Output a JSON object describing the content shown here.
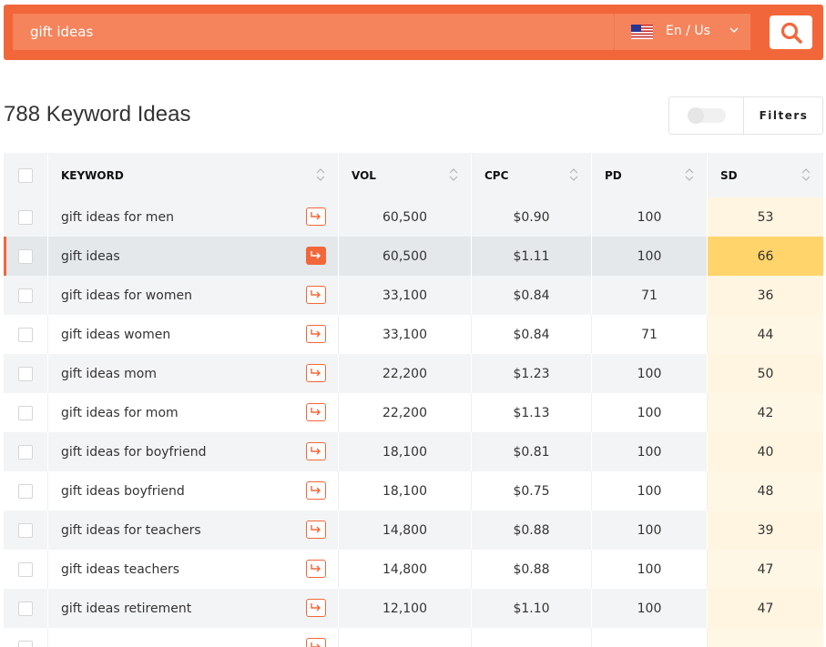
{
  "search": {
    "query": "gift ideas",
    "language": "En / Us"
  },
  "results": {
    "title": "788 Keyword Ideas",
    "filters_label": "Filters"
  },
  "table": {
    "columns": [
      "KEYWORD",
      "VOL",
      "CPC",
      "PD",
      "SD"
    ],
    "rows": [
      {
        "keyword": "gift ideas for men",
        "vol": "60,500",
        "cpc": "$0.90",
        "pd": "100",
        "sd": "53"
      },
      {
        "keyword": "gift ideas",
        "vol": "60,500",
        "cpc": "$1.11",
        "pd": "100",
        "sd": "66"
      },
      {
        "keyword": "gift ideas for women",
        "vol": "33,100",
        "cpc": "$0.84",
        "pd": "71",
        "sd": "36"
      },
      {
        "keyword": "gift ideas women",
        "vol": "33,100",
        "cpc": "$0.84",
        "pd": "71",
        "sd": "44"
      },
      {
        "keyword": "gift ideas mom",
        "vol": "22,200",
        "cpc": "$1.23",
        "pd": "100",
        "sd": "50"
      },
      {
        "keyword": "gift ideas for mom",
        "vol": "22,200",
        "cpc": "$1.13",
        "pd": "100",
        "sd": "42"
      },
      {
        "keyword": "gift ideas for boyfriend",
        "vol": "18,100",
        "cpc": "$0.81",
        "pd": "100",
        "sd": "40"
      },
      {
        "keyword": "gift ideas boyfriend",
        "vol": "18,100",
        "cpc": "$0.75",
        "pd": "100",
        "sd": "48"
      },
      {
        "keyword": "gift ideas for teachers",
        "vol": "14,800",
        "cpc": "$0.88",
        "pd": "100",
        "sd": "39"
      },
      {
        "keyword": "gift ideas teachers",
        "vol": "14,800",
        "cpc": "$0.88",
        "pd": "100",
        "sd": "47"
      },
      {
        "keyword": "gift ideas retirement",
        "vol": "12,100",
        "cpc": "$1.10",
        "pd": "100",
        "sd": "47"
      }
    ]
  },
  "colors": {
    "accent": "#f2673a",
    "sd_highlight": "#ffd46b"
  },
  "icons": {
    "search": "search-icon",
    "flag": "us-flag-icon",
    "dropdown": "chevron-down-icon",
    "sort": "sort-icon",
    "row_action": "arrow-return-icon"
  }
}
